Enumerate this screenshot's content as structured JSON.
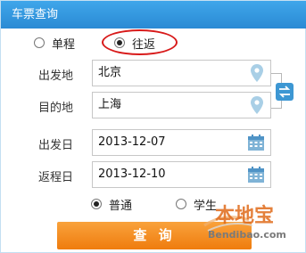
{
  "header": {
    "title": "车票查询"
  },
  "trip_type": {
    "options": [
      {
        "label": "单程",
        "checked": false
      },
      {
        "label": "往返",
        "checked": true
      }
    ]
  },
  "fields": {
    "from": {
      "label": "出发地",
      "value": "北京"
    },
    "to": {
      "label": "目的地",
      "value": "上海"
    },
    "depart_date": {
      "label": "出发日",
      "value": "2013-12-07"
    },
    "return_date": {
      "label": "返程日",
      "value": "2013-12-10"
    }
  },
  "passenger_type": {
    "options": [
      {
        "label": "普通",
        "checked": true
      },
      {
        "label": "学生",
        "checked": false
      }
    ]
  },
  "actions": {
    "search_label": "查 询"
  },
  "watermark": {
    "logo_text": "本地宝",
    "url": "Bendibao.com"
  },
  "colors": {
    "header_bg": "#2f95de",
    "accent_orange": "#f28a1a",
    "highlight_red": "#d81a1a",
    "icon_blue": "#3d97d3"
  }
}
